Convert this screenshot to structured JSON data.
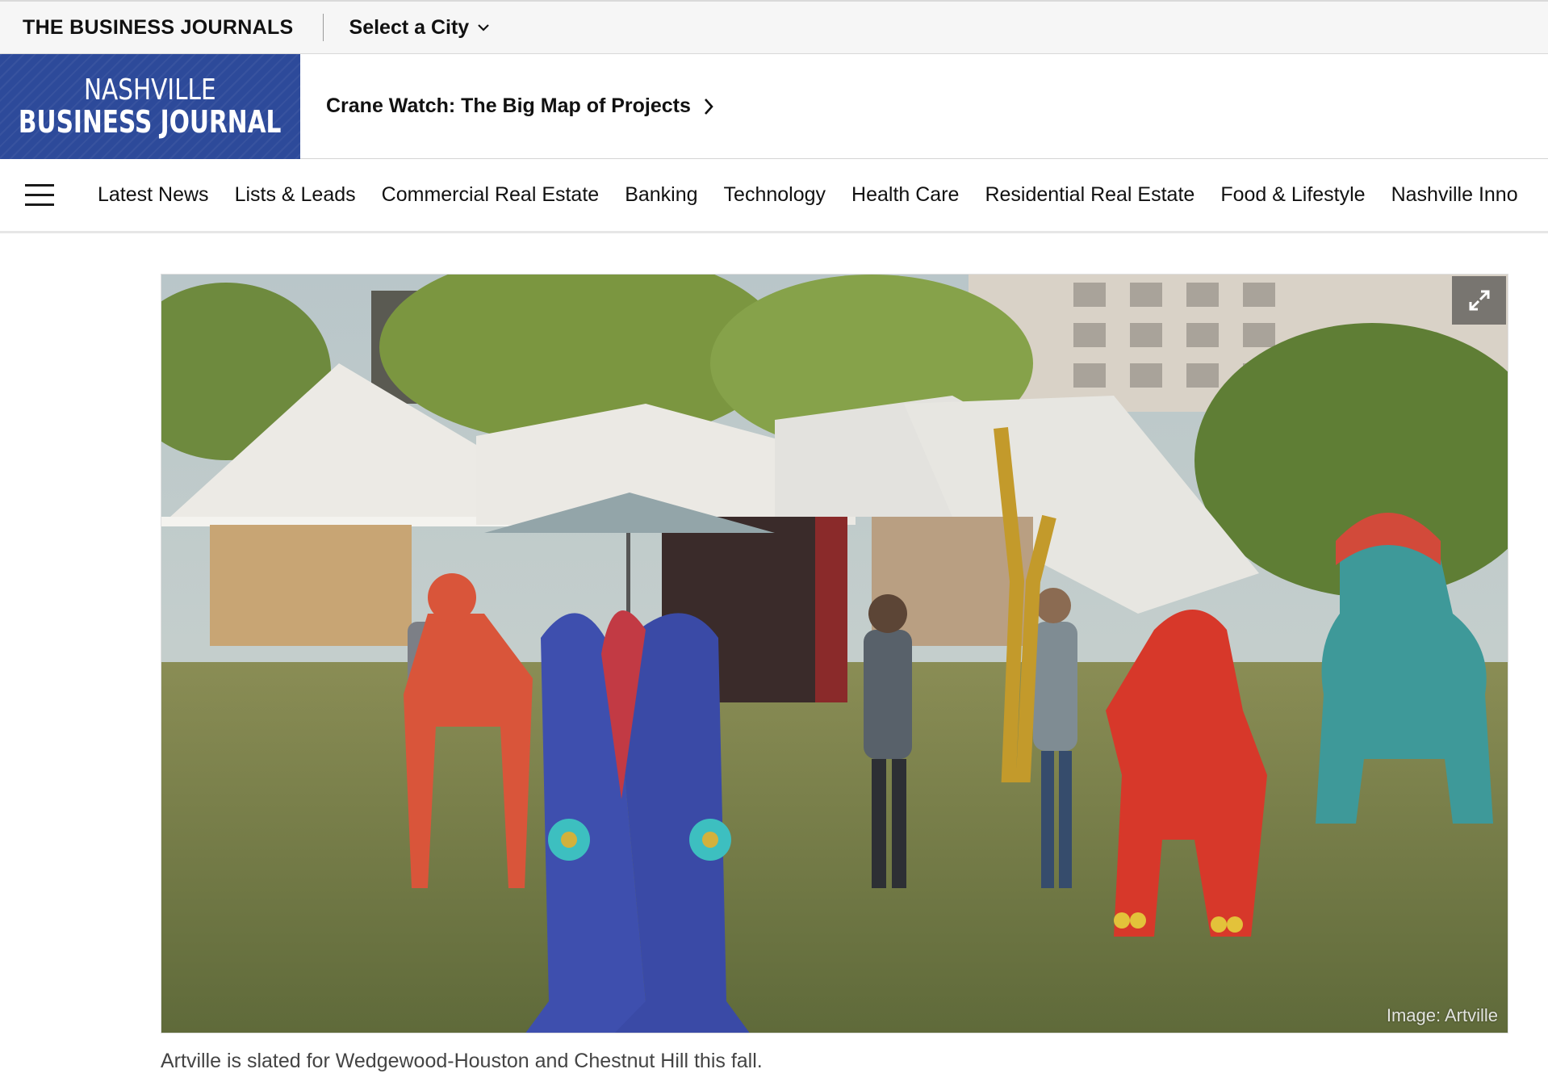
{
  "topbar": {
    "brand": "THE BUSINESS JOURNALS",
    "city_select": "Select a City",
    "chevron_icon": "chevron-down-icon"
  },
  "masthead": {
    "logo_line1": "NASHVILLE",
    "logo_line2": "BUSINESS JOURNAL",
    "logo_color": "#2d4a9a",
    "promo_label": "Crane Watch: The Big Map of Projects",
    "promo_icon": "chevron-right-icon"
  },
  "nav": {
    "menu_icon": "hamburger-menu-icon",
    "items": [
      "Latest News",
      "Lists & Leads",
      "Commercial Real Estate",
      "Banking",
      "Technology",
      "Health Care",
      "Residential Real Estate",
      "Food & Lifestyle",
      "Nashville Inno"
    ]
  },
  "figure": {
    "expand_icon": "expand-icon",
    "credit": "Image: Artville",
    "caption": "Artville is slated for Wedgewood-Houston and Chestnut Hill this fall."
  }
}
